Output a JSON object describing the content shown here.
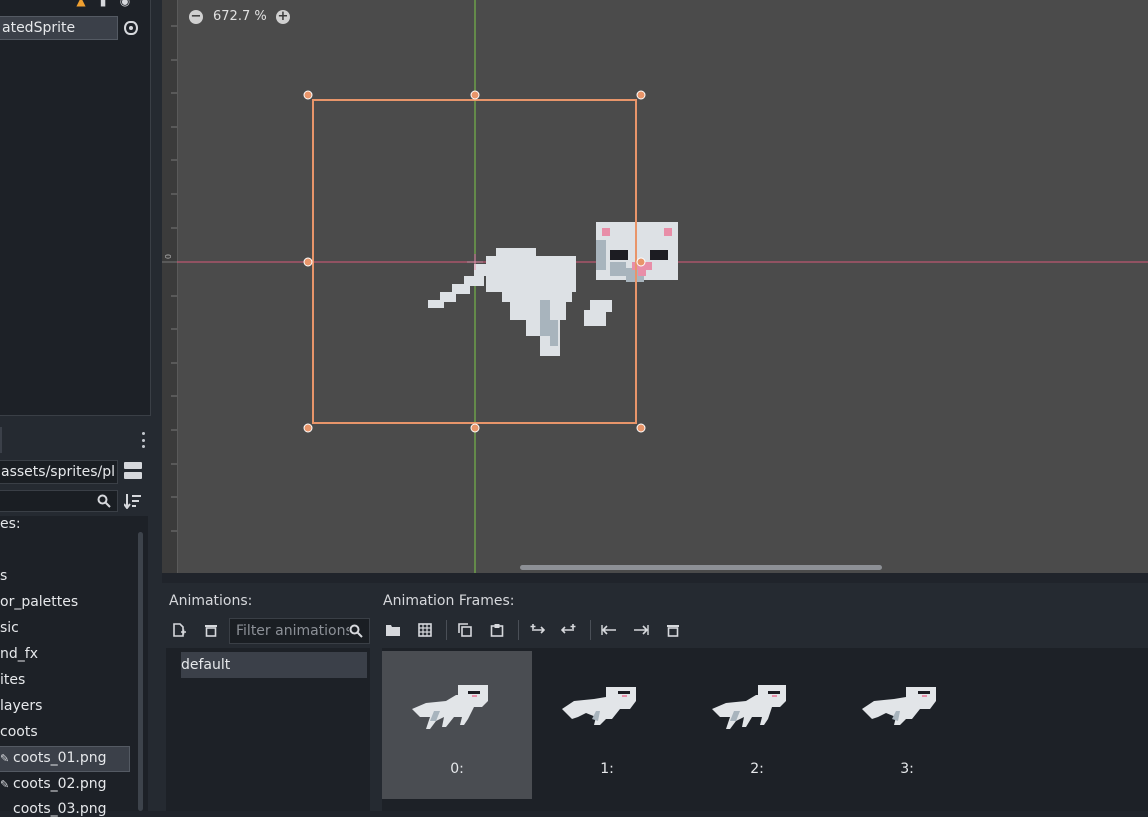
{
  "scene": {
    "node_name": "atedSprite"
  },
  "filesystem": {
    "path": "assets/sprites/pl",
    "header_label": "es:",
    "items": [
      "s",
      "or_palettes",
      "sic",
      "nd_fx",
      "ites",
      "layers",
      "coots",
      "coots_01.png",
      "coots_02.png",
      "coots_03.png"
    ]
  },
  "viewport": {
    "zoom_label": "672.7 %",
    "ruler_zero": "0"
  },
  "animations": {
    "title": "Animations:",
    "filter_placeholder": "Filter animations",
    "list": [
      "default"
    ]
  },
  "frames": {
    "title": "Animation Frames:",
    "items": [
      {
        "label": "0:",
        "selected": true
      },
      {
        "label": "1:",
        "selected": false
      },
      {
        "label": "2:",
        "selected": false
      },
      {
        "label": "3:",
        "selected": false
      }
    ]
  },
  "colors": {
    "selection_orange": "#e8956a",
    "axis_x": "#d75a7a",
    "axis_y": "#7ec94a",
    "warning": "#f0a030"
  },
  "icons": [
    "warning-icon",
    "script-icon",
    "visibility-icon",
    "zoom-out-icon",
    "zoom-in-icon",
    "search-icon",
    "sort-icon",
    "new-animation-icon",
    "delete-animation-icon",
    "load-frames-icon",
    "sprite-sheet-icon",
    "copy-icon",
    "paste-icon",
    "insert-before-icon",
    "insert-after-icon",
    "move-left-icon",
    "move-right-icon",
    "delete-frame-icon"
  ]
}
